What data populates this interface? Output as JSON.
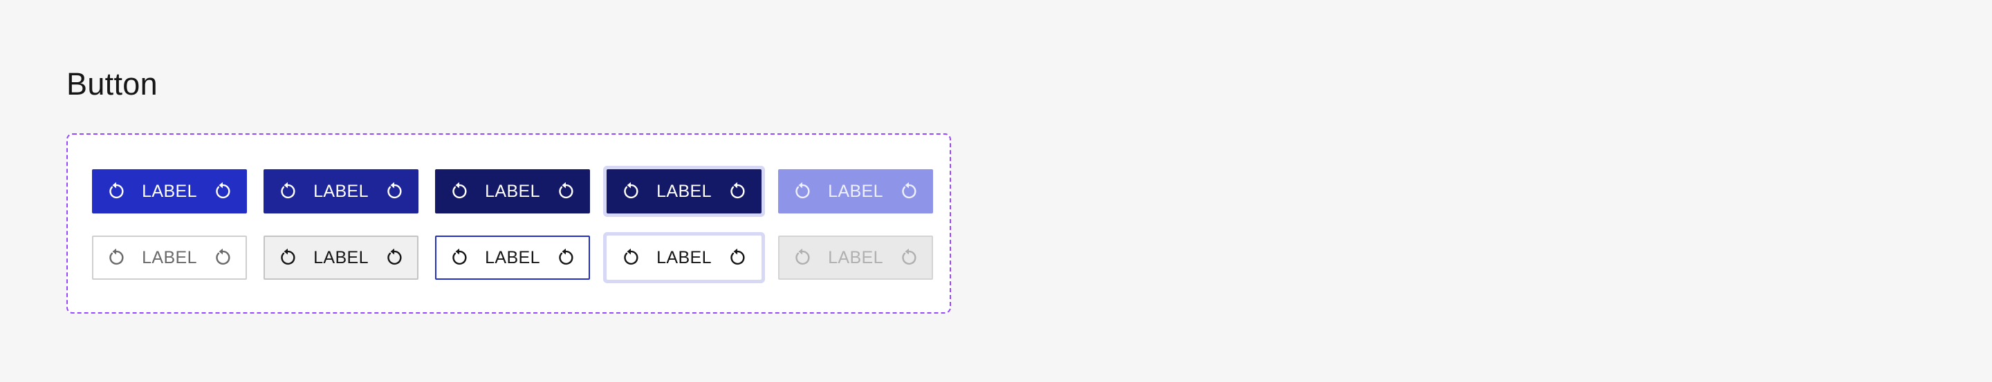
{
  "page": {
    "title": "Button"
  },
  "showcase": {
    "border_color": "#9747ff",
    "icon": "reset-icon",
    "rows": [
      {
        "variant": "primary",
        "buttons": [
          {
            "state": "default",
            "label": "LABEL",
            "background": "#232fc4"
          },
          {
            "state": "hover",
            "label": "LABEL",
            "background": "#1d2599"
          },
          {
            "state": "pressed",
            "label": "LABEL",
            "background": "#131867"
          },
          {
            "state": "focus",
            "label": "LABEL",
            "background": "#131867"
          },
          {
            "state": "disabled",
            "label": "LABEL",
            "background": "#8e95e8"
          }
        ]
      },
      {
        "variant": "secondary",
        "buttons": [
          {
            "state": "default",
            "label": "LABEL",
            "background": "#ffffff"
          },
          {
            "state": "hover",
            "label": "LABEL",
            "background": "#f0f0f0"
          },
          {
            "state": "pressed",
            "label": "LABEL",
            "background": "#ffffff"
          },
          {
            "state": "focus",
            "label": "LABEL",
            "background": "#ffffff"
          },
          {
            "state": "disabled",
            "label": "LABEL",
            "background": "#e9e9e9"
          }
        ]
      }
    ]
  }
}
